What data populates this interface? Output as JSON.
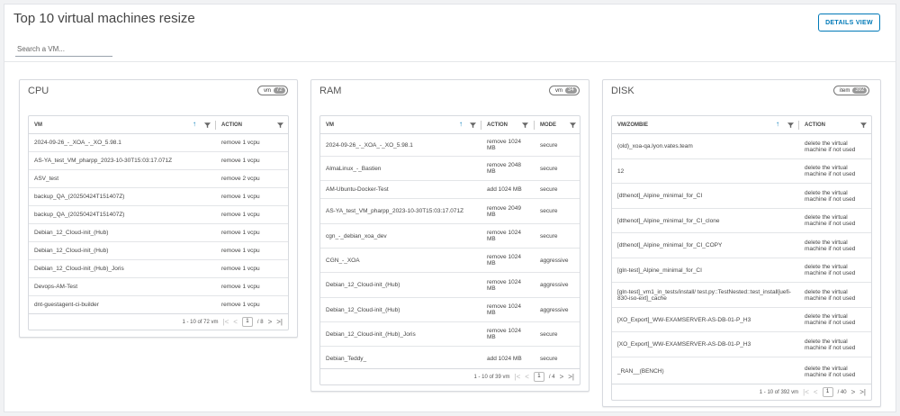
{
  "header": {
    "title": "Top 10 virtual machines resize",
    "search_placeholder": "Search a VM...",
    "details_button": "DETAILS VIEW"
  },
  "cpu": {
    "title": "CPU",
    "badge_label": "vm",
    "badge_count": "72",
    "columns": {
      "vm": "VM",
      "action": "ACTION"
    },
    "rows": [
      {
        "vm": "2024-09-26_-_XOA_-_XO_5.98.1",
        "action": "remove 1 vcpu"
      },
      {
        "vm": "AS-YA_test_VM_pharpp_2023-10-30T15:03:17.071Z",
        "action": "remove 1 vcpu"
      },
      {
        "vm": "ASV_test",
        "action": "remove 2 vcpu"
      },
      {
        "vm": "backup_QA_(20250424T151407Z)",
        "action": "remove 1 vcpu"
      },
      {
        "vm": "backup_QA_(20250424T151407Z)",
        "action": "remove 1 vcpu"
      },
      {
        "vm": "Debian_12_Cloud-init_(Hub)",
        "action": "remove 1 vcpu"
      },
      {
        "vm": "Debian_12_Cloud-init_(Hub)",
        "action": "remove 1 vcpu"
      },
      {
        "vm": "Debian_12_Cloud-init_(Hub)_Joris",
        "action": "remove 1 vcpu"
      },
      {
        "vm": "Devops-AM-Test",
        "action": "remove 1 vcpu"
      },
      {
        "vm": "dnt-guestagent-ci-builder",
        "action": "remove 1 vcpu"
      }
    ],
    "footer": {
      "range": "1 - 10 of 72 vm",
      "page": "1",
      "total_pages": "/ 8"
    }
  },
  "ram": {
    "title": "RAM",
    "badge_label": "vm",
    "badge_count": "34",
    "columns": {
      "vm": "VM",
      "action": "ACTION",
      "mode": "MODE"
    },
    "rows": [
      {
        "vm": "2024-09-26_-_XOA_-_XO_5.98.1",
        "action": "remove 1024 MB",
        "mode": "secure"
      },
      {
        "vm": "AlmaLinux_-_Bastien",
        "action": "remove 2048 MB",
        "mode": "secure"
      },
      {
        "vm": "AM-Ubuntu-Docker-Test",
        "action": "add 1024 MB",
        "mode": "secure"
      },
      {
        "vm": "AS-YA_test_VM_pharpp_2023-10-30T15:03:17.071Z",
        "action": "remove 2049 MB",
        "mode": "secure"
      },
      {
        "vm": "cgn_-_debian_xoa_dev",
        "action": "remove 1024 MB",
        "mode": "secure"
      },
      {
        "vm": "CGN_-_XOA",
        "action": "remove 1024 MB",
        "mode": "aggressive"
      },
      {
        "vm": "Debian_12_Cloud-init_(Hub)",
        "action": "remove 1024 MB",
        "mode": "aggressive"
      },
      {
        "vm": "Debian_12_Cloud-init_(Hub)",
        "action": "remove 1024 MB",
        "mode": "aggressive"
      },
      {
        "vm": "Debian_12_Cloud-init_(Hub)_Joris",
        "action": "remove 1024 MB",
        "mode": "secure"
      },
      {
        "vm": "Debian_Teddy_",
        "action": "add 1024 MB",
        "mode": "secure"
      }
    ],
    "footer": {
      "range": "1 - 10 of 39 vm",
      "page": "1",
      "total_pages": "/ 4"
    }
  },
  "disk": {
    "title": "DISK",
    "badge_label": "item",
    "badge_count": "392",
    "columns": {
      "vm": "VM/ZOMBIE",
      "action": "ACTION"
    },
    "rows": [
      {
        "vm": "(old)_xoa-qa.lyon.vates.team",
        "action": "delete the virtual machine if not used"
      },
      {
        "vm": "12",
        "action": "delete the virtual machine if not used"
      },
      {
        "vm": "[dthenot]_Alpine_minimal_for_CI",
        "action": "delete the virtual machine if not used"
      },
      {
        "vm": "[dthenot]_Alpine_minimal_for_CI_clone",
        "action": "delete the virtual machine if not used"
      },
      {
        "vm": "[dthenot]_Alpine_minimal_for_CI_COPY",
        "action": "delete the virtual machine if not used"
      },
      {
        "vm": "[gln-test]_Alpine_minimal_for_CI",
        "action": "delete the virtual machine if not used"
      },
      {
        "vm": "[gln-test]_vm1_in_tests/install/ test.py::TestNested::test_install[uefi-830-iso-ext]_cache",
        "action": "delete the virtual machine if not used"
      },
      {
        "vm": "[XO_Export]_WW-EXAMSERVER-AS-DB-01-P_H3",
        "action": "delete the virtual machine if not used"
      },
      {
        "vm": "[XO_Export]_WW-EXAMSERVER-AS-DB-01-P_H3",
        "action": "delete the virtual machine if not used"
      },
      {
        "vm": "_RAN__(BENCH)",
        "action": "delete the virtual machine if not used"
      }
    ],
    "footer": {
      "range": "1 - 10 of 392 vm",
      "page": "1",
      "total_pages": "/ 40"
    }
  }
}
